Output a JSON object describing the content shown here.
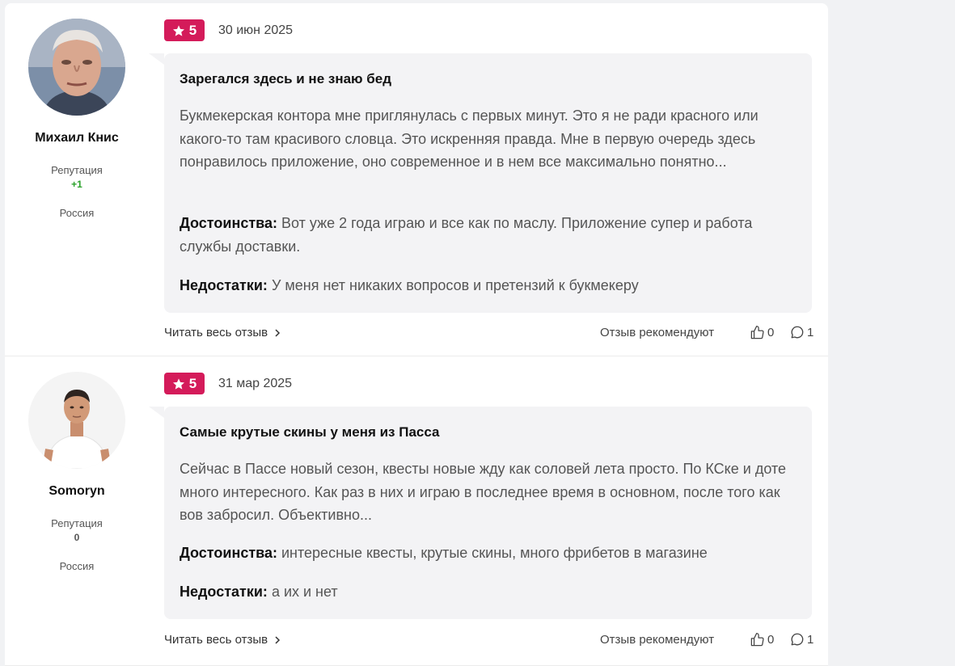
{
  "reviews": [
    {
      "author": {
        "name": "Михаил Книс",
        "reputation_label": "Репутация",
        "reputation_value": "+1",
        "country": "Россия",
        "avatar_icon": "avatar-elderly-man-photo"
      },
      "rating": "5",
      "date": "30 июн 2025",
      "title": "Зарегался здесь и не знаю бед",
      "text": "Букмекерская контора мне приглянулась с первых минут. Это я не ради красного или какого-то там красивого словца. Это искренняя правда. Мне в первую очередь здесь понравилось приложение, оно современное и в нем все максимально понятно...",
      "pros_label": "Достоинства:",
      "pros": "Вот уже 2 года играю и все как по маслу. Приложение супер и работа службы доставки.",
      "cons_label": "Недостатки:",
      "cons": "У меня нет никаких вопросов и претензий к букмекеру",
      "read_more": "Читать весь отзыв",
      "recommend_label": "Отзыв рекомендуют",
      "likes": "0",
      "comments": "1"
    },
    {
      "author": {
        "name": "Somoryn",
        "reputation_label": "Репутация",
        "reputation_value": "0",
        "country": "Россия",
        "avatar_icon": "avatar-young-man-photo"
      },
      "rating": "5",
      "date": "31 мар 2025",
      "title": "Самые крутые скины у меня из Пасса",
      "text": "Сейчас в Пассе новый сезон, квесты новые жду как соловей лета просто. По КСке и доте много интересного. Как раз в них и играю в последнее время в основном, после того как вов забросил. Объективно...",
      "pros_label": "Достоинства:",
      "pros": "интересные квесты, крутые скины, много фрибетов в магазине",
      "cons_label": "Недостатки:",
      "cons": "а их и нет",
      "read_more": "Читать весь отзыв",
      "recommend_label": "Отзыв рекомендуют",
      "likes": "0",
      "comments": "1"
    }
  ],
  "colors": {
    "rating_badge": "#d41b5a",
    "positive_reputation": "#2aa12a",
    "bubble_bg": "#f3f3f5"
  },
  "icons": {
    "star": "star-icon",
    "like": "thumbs-up-icon",
    "comment": "comment-bubble-icon",
    "chevron": "chevron-right-icon"
  }
}
